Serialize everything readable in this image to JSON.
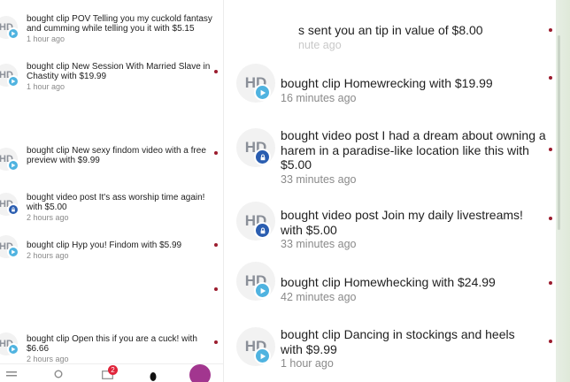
{
  "left_notifications": [
    {
      "avatar": "HD",
      "badge": "play-icon",
      "text": "bought clip POV Telling you my cuckold fantasy and cumming while telling you it  with $5.15",
      "time": "1 hour ago"
    },
    {
      "avatar": "HD",
      "badge": "play-icon",
      "text": "bought clip New Session With Married Slave in Chastity with $19.99",
      "time": "1 hour ago"
    },
    {
      "avatar": "HD",
      "badge": "play-icon",
      "text": "bought clip New sexy findom video with a free preview with $9.99",
      "time": ""
    },
    {
      "avatar": "HD",
      "badge": "lock-icon",
      "text": "bought video post It's ass worship time again! with $5.00",
      "time": "2 hours ago"
    },
    {
      "avatar": "HD",
      "badge": "play-icon",
      "text": "bought clip Hyp you! Findom with $5.99",
      "time": "2 hours ago"
    },
    {
      "avatar": "HD",
      "badge": "play-icon",
      "text": "bought clip Open this if you are a cuck! with $6.66",
      "time": "2 hours ago"
    }
  ],
  "right_top": {
    "text": "s sent you an tip in value of $8.00",
    "time": "nute ago"
  },
  "right_notifications": [
    {
      "avatar": "HD",
      "badge": "play-icon",
      "text": "bought clip Homewrecking  with $19.99",
      "time": "16 minutes ago"
    },
    {
      "avatar": "HD",
      "badge": "lock-icon",
      "text": "bought video post I had a dream about owning a harem in a paradise-like location like this with $5.00",
      "time": "33 minutes ago"
    },
    {
      "avatar": "HD",
      "badge": "lock-icon",
      "text": "bought video post Join my daily livestreams! with $5.00",
      "time": "33 minutes ago"
    },
    {
      "avatar": "HD",
      "badge": "play-icon",
      "text": "bought clip Homewhecking  with $24.99",
      "time": "42 minutes ago"
    },
    {
      "avatar": "HD",
      "badge": "play-icon",
      "text": "bought clip Dancing in stockings and heels with $9.99",
      "time": "1 hour ago"
    }
  ],
  "bottom_nav": {
    "items": [
      "home-icon",
      "search-icon",
      "messages-icon",
      "profile-icon",
      "avatar"
    ],
    "message_count": "2"
  },
  "colors": {
    "accent": "#4fb3e0",
    "lock_badge": "#2a5db0",
    "unread_dot": "#9b1c2e",
    "notif_badge": "#e0243a"
  }
}
